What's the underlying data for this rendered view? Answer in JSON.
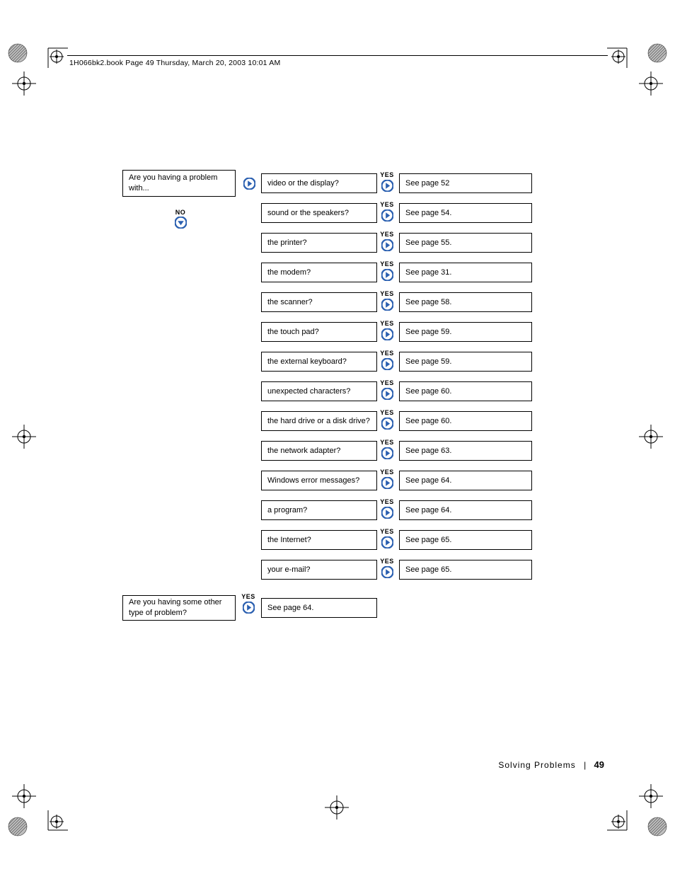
{
  "header": "1H066bk2.book  Page 49  Thursday, March 20, 2003  10:01 AM",
  "q1": "Are you having a problem with...",
  "q2": "Are you having some other type of problem?",
  "no_label": "NO",
  "yes_label": "YES",
  "rows": [
    {
      "q": "video or the display?",
      "a": "See page 52"
    },
    {
      "q": "sound or the speakers?",
      "a": "See page 54."
    },
    {
      "q": "the printer?",
      "a": "See page 55."
    },
    {
      "q": "the modem?",
      "a": "See page 31."
    },
    {
      "q": "the scanner?",
      "a": "See page 58."
    },
    {
      "q": "the touch pad?",
      "a": "See page 59."
    },
    {
      "q": "the external keyboard?",
      "a": "See page 59."
    },
    {
      "q": "unexpected characters?",
      "a": "See page 60."
    },
    {
      "q": "the hard drive or a disk drive?",
      "a": "See page 60."
    },
    {
      "q": "the network adapter?",
      "a": "See page 63."
    },
    {
      "q": "Windows error messages?",
      "a": "See page 64."
    },
    {
      "q": "a program?",
      "a": "See page 64."
    },
    {
      "q": "the Internet?",
      "a": "See page 65."
    },
    {
      "q": "your e-mail?",
      "a": "See page 65."
    }
  ],
  "last_answer": "See page 64.",
  "footer_section": "Solving Problems",
  "footer_page": "49"
}
